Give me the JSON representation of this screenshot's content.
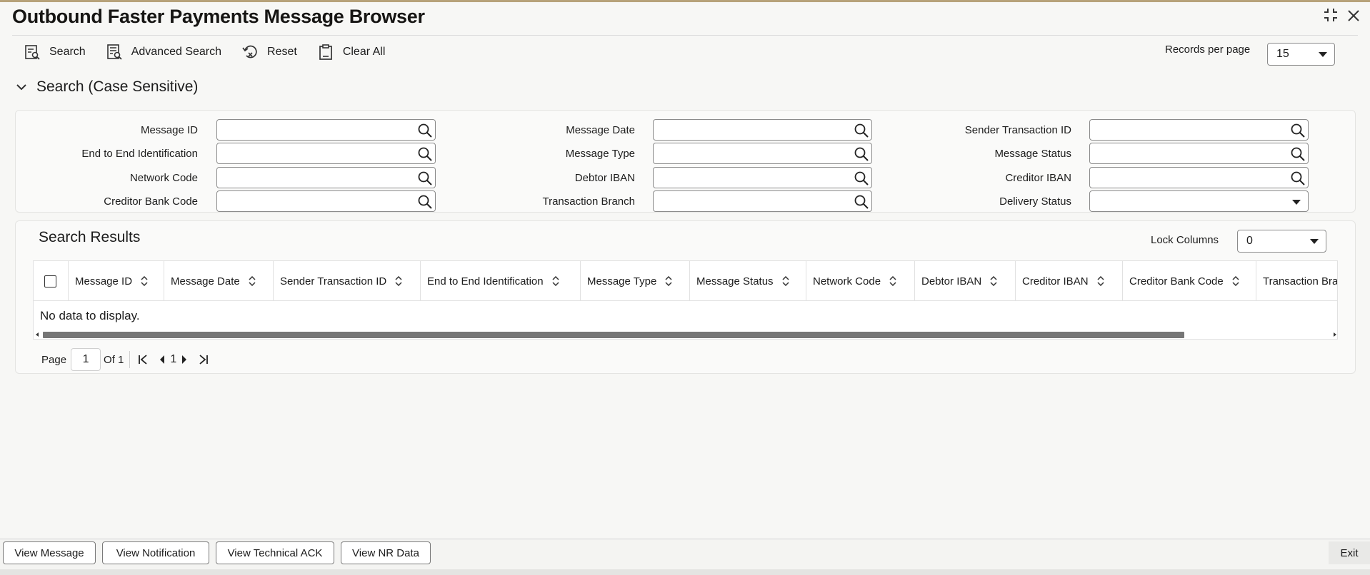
{
  "window": {
    "title": "Outbound Faster Payments Message Browser"
  },
  "toolbar": {
    "search": "Search",
    "advanced_search": "Advanced Search",
    "reset": "Reset",
    "clear_all": "Clear All"
  },
  "records_per_page": {
    "label": "Records per page",
    "value": "15"
  },
  "search_section": {
    "title": "Search (Case Sensitive)"
  },
  "search_fields": {
    "message_id": "Message ID",
    "message_date": "Message Date",
    "sender_transaction_id": "Sender Transaction ID",
    "end_to_end_identification": "End to End Identification",
    "message_type": "Message Type",
    "message_status": "Message Status",
    "network_code": "Network Code",
    "debtor_iban": "Debtor IBAN",
    "creditor_iban": "Creditor IBAN",
    "creditor_bank_code": "Creditor Bank Code",
    "transaction_branch": "Transaction Branch",
    "delivery_status": "Delivery Status"
  },
  "results": {
    "title": "Search Results",
    "lock_columns_label": "Lock Columns",
    "lock_columns_value": "0",
    "columns": [
      "Message ID",
      "Message Date",
      "Sender Transaction ID",
      "End to End Identification",
      "Message Type",
      "Message Status",
      "Network Code",
      "Debtor IBAN",
      "Creditor IBAN",
      "Creditor Bank Code",
      "Transaction Branch"
    ],
    "empty_text": "No data to display."
  },
  "pager": {
    "page_label": "Page",
    "page_value": "1",
    "of_label": "Of 1",
    "current": "1"
  },
  "footer": {
    "view_message": "View Message",
    "view_notification": "View Notification",
    "view_technical_ack": "View Technical ACK",
    "view_nr_data": "View NR Data",
    "exit": "Exit"
  },
  "colors": {
    "text": "#161513",
    "border": "#8b8b8b",
    "page_bg": "#f7f7f5"
  },
  "icons": [
    "search-icon",
    "advanced-search-icon",
    "reset-icon",
    "clear-all-icon",
    "chevron-down-icon",
    "magnifier-icon",
    "sort-icon",
    "first-page-icon",
    "prev-page-icon",
    "next-page-icon",
    "last-page-icon",
    "minimize-icon",
    "close-icon"
  ]
}
